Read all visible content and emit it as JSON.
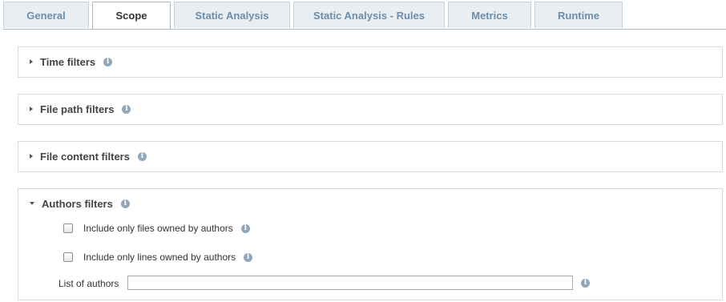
{
  "tabs": [
    {
      "label": "General",
      "active": false
    },
    {
      "label": "Scope",
      "active": true
    },
    {
      "label": "Static Analysis",
      "active": false
    },
    {
      "label": "Static Analysis - Rules",
      "active": false
    },
    {
      "label": "Metrics",
      "active": false
    },
    {
      "label": "Runtime",
      "active": false
    }
  ],
  "sections": {
    "time": {
      "title": "Time filters",
      "expanded": false
    },
    "file_path": {
      "title": "File path filters",
      "expanded": false
    },
    "file_content": {
      "title": "File content filters",
      "expanded": false
    },
    "authors": {
      "title": "Authors filters",
      "expanded": true,
      "option_files": {
        "label": "Include only files owned by authors",
        "checked": false
      },
      "option_lines": {
        "label": "Include only lines owned by authors",
        "checked": false
      },
      "list_label": "List of authors",
      "list_value": ""
    }
  },
  "icons": {
    "info": "i"
  },
  "colors": {
    "tab_text": "#6b8eab",
    "tab_bg": "#e9eef3",
    "info_icon": "#8fa6bb",
    "border": "#d6dbe0"
  }
}
